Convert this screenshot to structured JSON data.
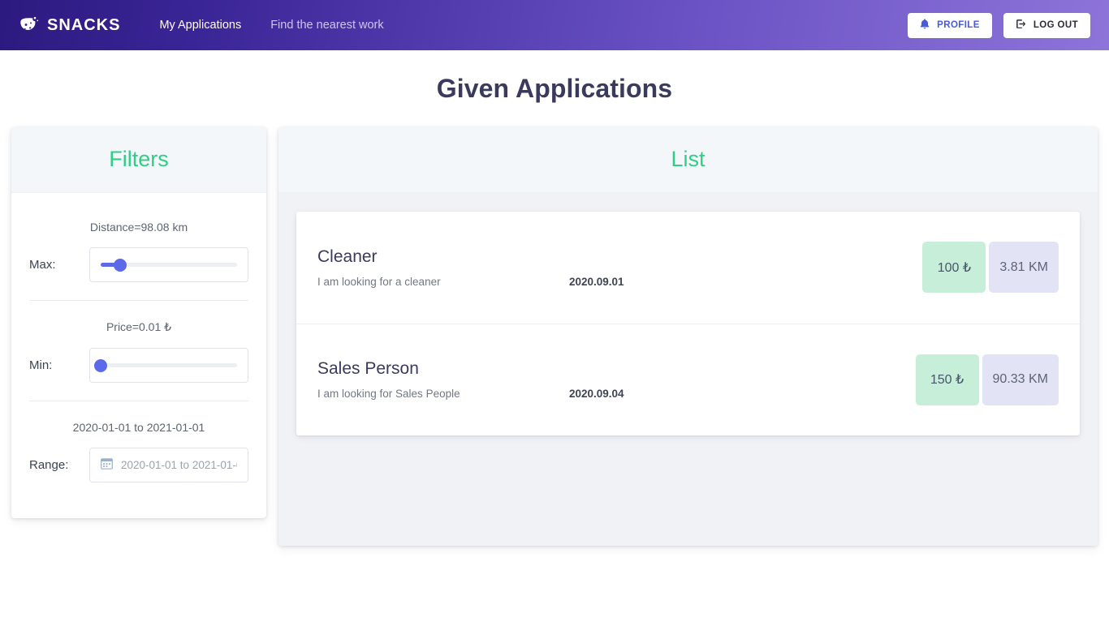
{
  "navbar": {
    "brand": "SNACKS",
    "brand_icon": "cookie-icon",
    "links": [
      {
        "label": "My Applications",
        "active": true
      },
      {
        "label": "Find the nearest work",
        "active": false
      }
    ],
    "buttons": [
      {
        "label": "PROFILE",
        "icon": "bell-icon",
        "style": "profile"
      },
      {
        "label": "LOG OUT",
        "icon": "sign-out-icon",
        "style": "logout"
      }
    ],
    "gradient_from": "#2c1a7f",
    "gradient_to": "#8d74d9"
  },
  "page": {
    "title": "Given Applications",
    "title_color": "#3b3a5e"
  },
  "filters": {
    "header": "Filters",
    "header_color": "#2fce86",
    "groups": [
      {
        "caption": "Distance=98.08 km",
        "label": "Max:",
        "control": "slider",
        "value_percent": 14
      },
      {
        "caption": "Price=0.01 ₺",
        "label": "Min:",
        "control": "slider",
        "value_percent": 0
      },
      {
        "caption": "2020-01-01 to 2021-01-01",
        "label": "Range:",
        "control": "daterange",
        "field_value": "2020-01-01 to 2021-01-01",
        "field_icon": "calendar-icon"
      }
    ]
  },
  "list": {
    "header": "List",
    "header_color": "#2fce86",
    "items": [
      {
        "title": "Cleaner",
        "description": "I am looking for a cleaner",
        "date": "2020.09.01",
        "price": "100 ₺",
        "distance": "3.81 KM"
      },
      {
        "title": "Sales Person",
        "description": "I am looking for Sales People",
        "date": "2020.09.04",
        "price": "150 ₺",
        "distance": "90.33 KM"
      }
    ],
    "badge_price_color": "#c7eed9",
    "badge_distance_color": "#e2e3f5"
  }
}
